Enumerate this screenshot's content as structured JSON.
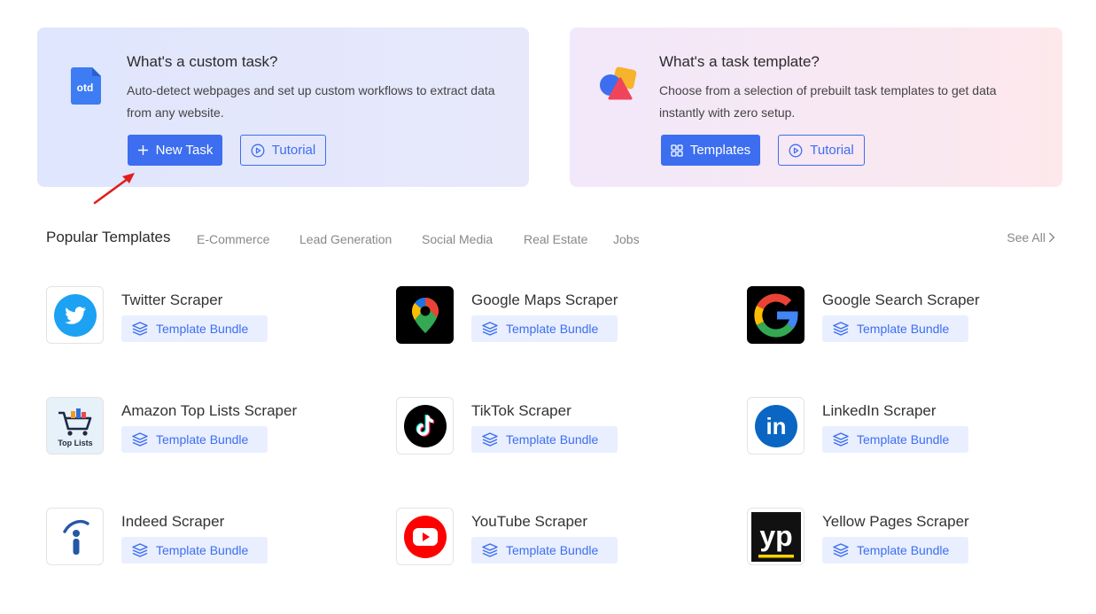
{
  "custom_card": {
    "icon_text": "otd",
    "title": "What's a custom task?",
    "description": "Auto-detect webpages and set up custom workflows to extract data from any website.",
    "new_task_label": "New Task",
    "tutorial_label": "Tutorial"
  },
  "template_card": {
    "title": "What's a task template?",
    "description": "Choose from a selection of prebuilt task templates to get data instantly with zero setup.",
    "templates_label": "Templates",
    "tutorial_label": "Tutorial"
  },
  "tabs": {
    "active": "Popular Templates",
    "items": [
      "E-Commerce",
      "Lead Generation",
      "Social Media",
      "Real Estate",
      "Jobs"
    ],
    "see_all": "See All"
  },
  "templates": [
    {
      "name": "Twitter Scraper",
      "badge": "Template Bundle",
      "icon": "twitter-icon"
    },
    {
      "name": "Google Maps Scraper",
      "badge": "Template Bundle",
      "icon": "google-maps-icon"
    },
    {
      "name": "Google Search Scraper",
      "badge": "Template Bundle",
      "icon": "google-icon"
    },
    {
      "name": "Amazon Top Lists Scraper",
      "badge": "Template Bundle",
      "icon": "amazon-top-lists-icon",
      "logo_text": "Top Lists"
    },
    {
      "name": "TikTok Scraper",
      "badge": "Template Bundle",
      "icon": "tiktok-icon"
    },
    {
      "name": "LinkedIn Scraper",
      "badge": "Template Bundle",
      "icon": "linkedin-icon",
      "logo_text": "in"
    },
    {
      "name": "Indeed Scraper",
      "badge": "Template Bundle",
      "icon": "indeed-icon"
    },
    {
      "name": "YouTube Scraper",
      "badge": "Template Bundle",
      "icon": "youtube-icon"
    },
    {
      "name": "Yellow Pages Scraper",
      "badge": "Template Bundle",
      "icon": "yellow-pages-icon",
      "logo_text": "yp"
    }
  ],
  "colors": {
    "accent": "#3d6ef0",
    "badge_bg": "#e9efff",
    "annotation_arrow": "#e0201c"
  }
}
